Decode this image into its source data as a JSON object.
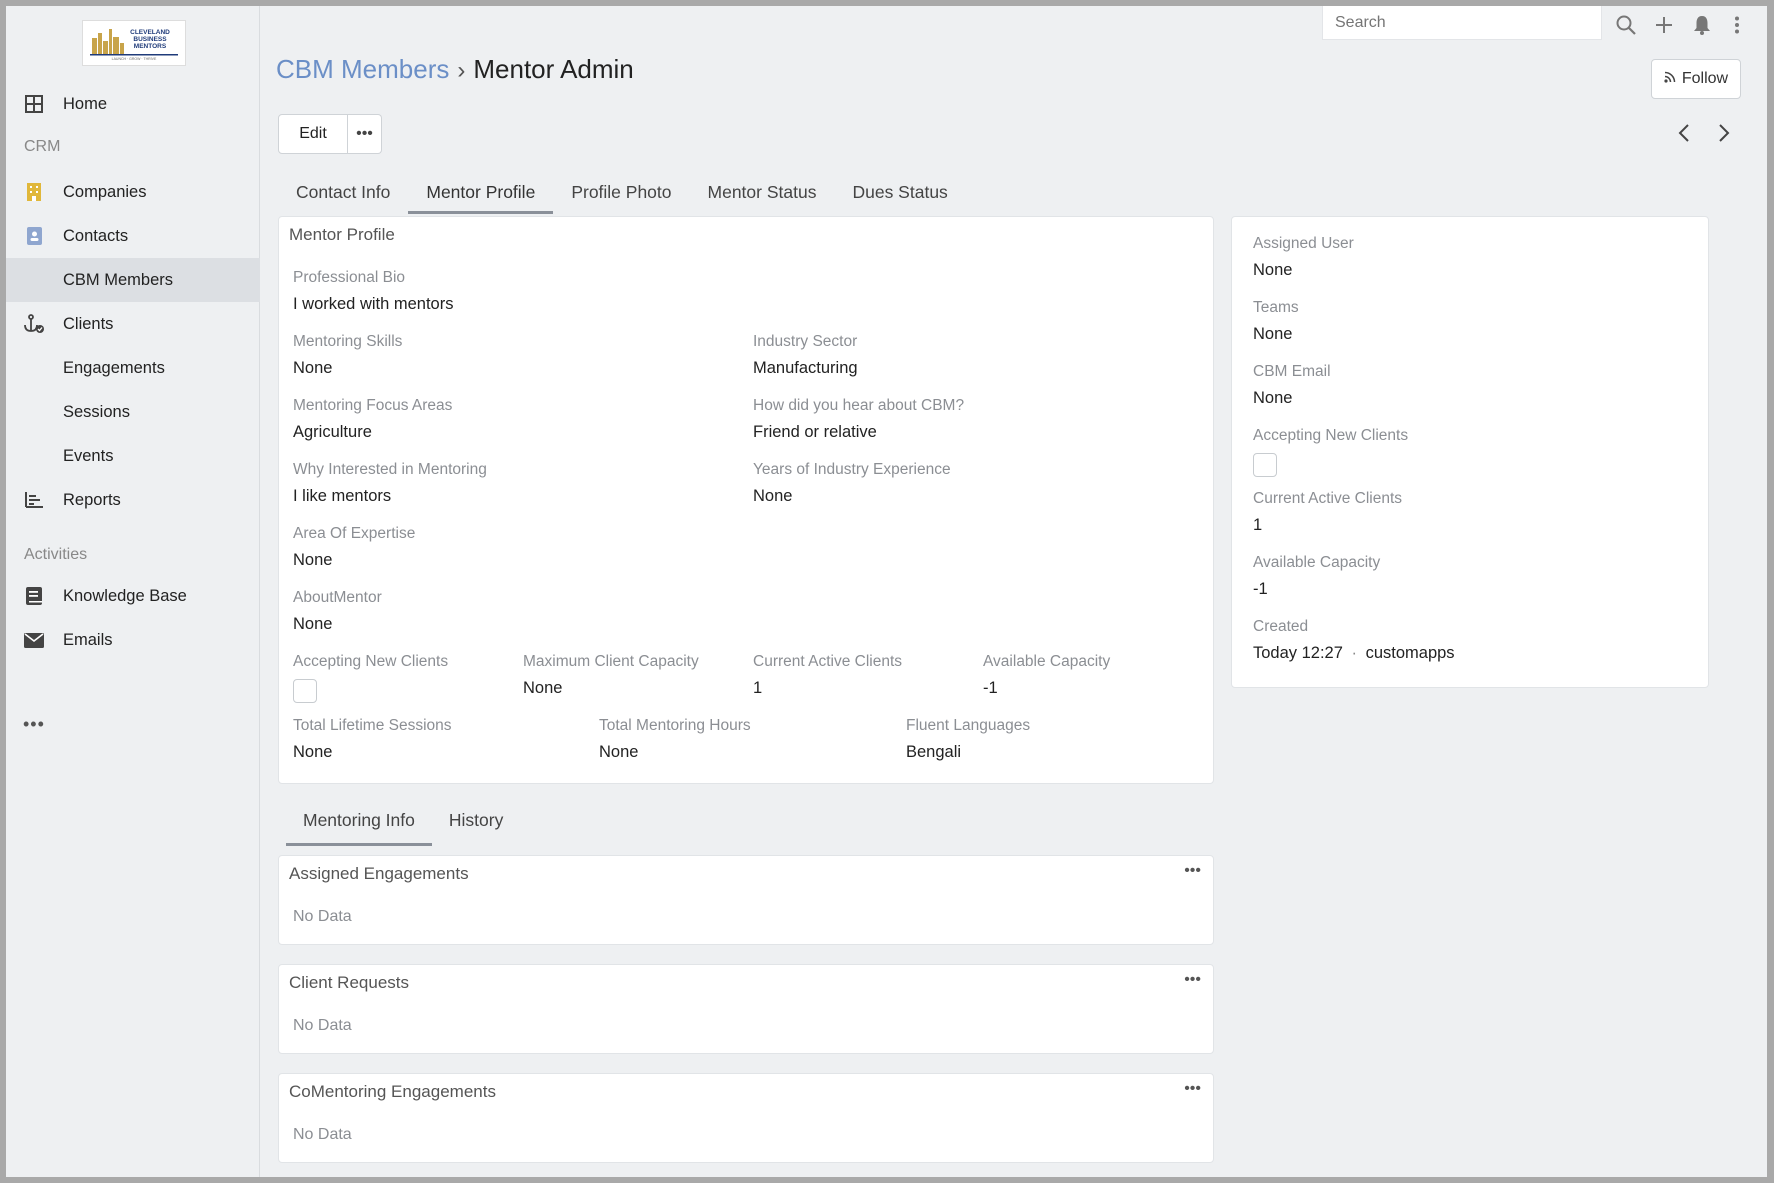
{
  "sidebar": {
    "logo_text": "CLEVELAND BUSINESS MENTORS",
    "items": [
      {
        "label": "Home"
      },
      {
        "label": "Companies"
      },
      {
        "label": "Contacts"
      },
      {
        "label": "CBM Members"
      },
      {
        "label": "Clients"
      },
      {
        "label": "Engagements"
      },
      {
        "label": "Sessions"
      },
      {
        "label": "Events"
      },
      {
        "label": "Reports"
      },
      {
        "label": "Knowledge Base"
      },
      {
        "label": "Emails"
      }
    ],
    "groups": {
      "crm": "CRM",
      "activities": "Activities"
    },
    "more": "•••"
  },
  "topbar": {
    "search_placeholder": "Search"
  },
  "header": {
    "breadcrumb_parent": "CBM Members",
    "breadcrumb_sep": "›",
    "breadcrumb_current": "Mentor Admin",
    "follow_label": "Follow",
    "edit_label": "Edit",
    "more_label": "•••"
  },
  "tabs": [
    {
      "label": "Contact Info"
    },
    {
      "label": "Mentor Profile"
    },
    {
      "label": "Profile Photo"
    },
    {
      "label": "Mentor Status"
    },
    {
      "label": "Dues Status"
    }
  ],
  "mentor_profile": {
    "title": "Mentor Profile",
    "professional_bio": {
      "label": "Professional Bio",
      "value": "I worked with mentors"
    },
    "mentoring_skills": {
      "label": "Mentoring Skills",
      "value": "None"
    },
    "industry_sector": {
      "label": "Industry Sector",
      "value": "Manufacturing"
    },
    "mentoring_focus_areas": {
      "label": "Mentoring Focus Areas",
      "value": "Agriculture"
    },
    "how_hear": {
      "label": "How did you hear about CBM?",
      "value": "Friend or relative"
    },
    "why_interested": {
      "label": "Why Interested in Mentoring",
      "value": "I like mentors"
    },
    "years_experience": {
      "label": "Years of Industry Experience",
      "value": "None"
    },
    "area_of_expertise": {
      "label": "Area Of Expertise",
      "value": "None"
    },
    "about_mentor": {
      "label": "AboutMentor",
      "value": "None"
    },
    "accepting_new_clients": {
      "label": "Accepting New Clients",
      "checked": false
    },
    "max_client_capacity": {
      "label": "Maximum Client Capacity",
      "value": "None"
    },
    "current_active_clients": {
      "label": "Current Active Clients",
      "value": "1"
    },
    "available_capacity": {
      "label": "Available Capacity",
      "value": "-1"
    },
    "total_lifetime_sessions": {
      "label": "Total Lifetime Sessions",
      "value": "None"
    },
    "total_mentoring_hours": {
      "label": "Total Mentoring Hours",
      "value": "None"
    },
    "fluent_languages": {
      "label": "Fluent Languages",
      "value": "Bengali"
    }
  },
  "side_panel": {
    "assigned_user": {
      "label": "Assigned User",
      "value": "None"
    },
    "teams": {
      "label": "Teams",
      "value": "None"
    },
    "cbm_email": {
      "label": "CBM Email",
      "value": "None"
    },
    "accepting_new_clients": {
      "label": "Accepting New Clients",
      "checked": false
    },
    "current_active_clients": {
      "label": "Current Active Clients",
      "value": "1"
    },
    "available_capacity": {
      "label": "Available Capacity",
      "value": "-1"
    },
    "created": {
      "label": "Created",
      "date": "Today 12:27",
      "dot": "·",
      "user": "customapps"
    }
  },
  "bottom_tabs": [
    {
      "label": "Mentoring Info"
    },
    {
      "label": "History"
    }
  ],
  "relations": [
    {
      "title": "Assigned Engagements",
      "empty": "No Data"
    },
    {
      "title": "Client Requests",
      "empty": "No Data"
    },
    {
      "title": "CoMentoring Engagements",
      "empty": "No Data"
    }
  ],
  "colors": {
    "link": "#6b8fc7",
    "companies_icon": "#e0b73a",
    "contacts_icon": "#8fa6cf"
  }
}
